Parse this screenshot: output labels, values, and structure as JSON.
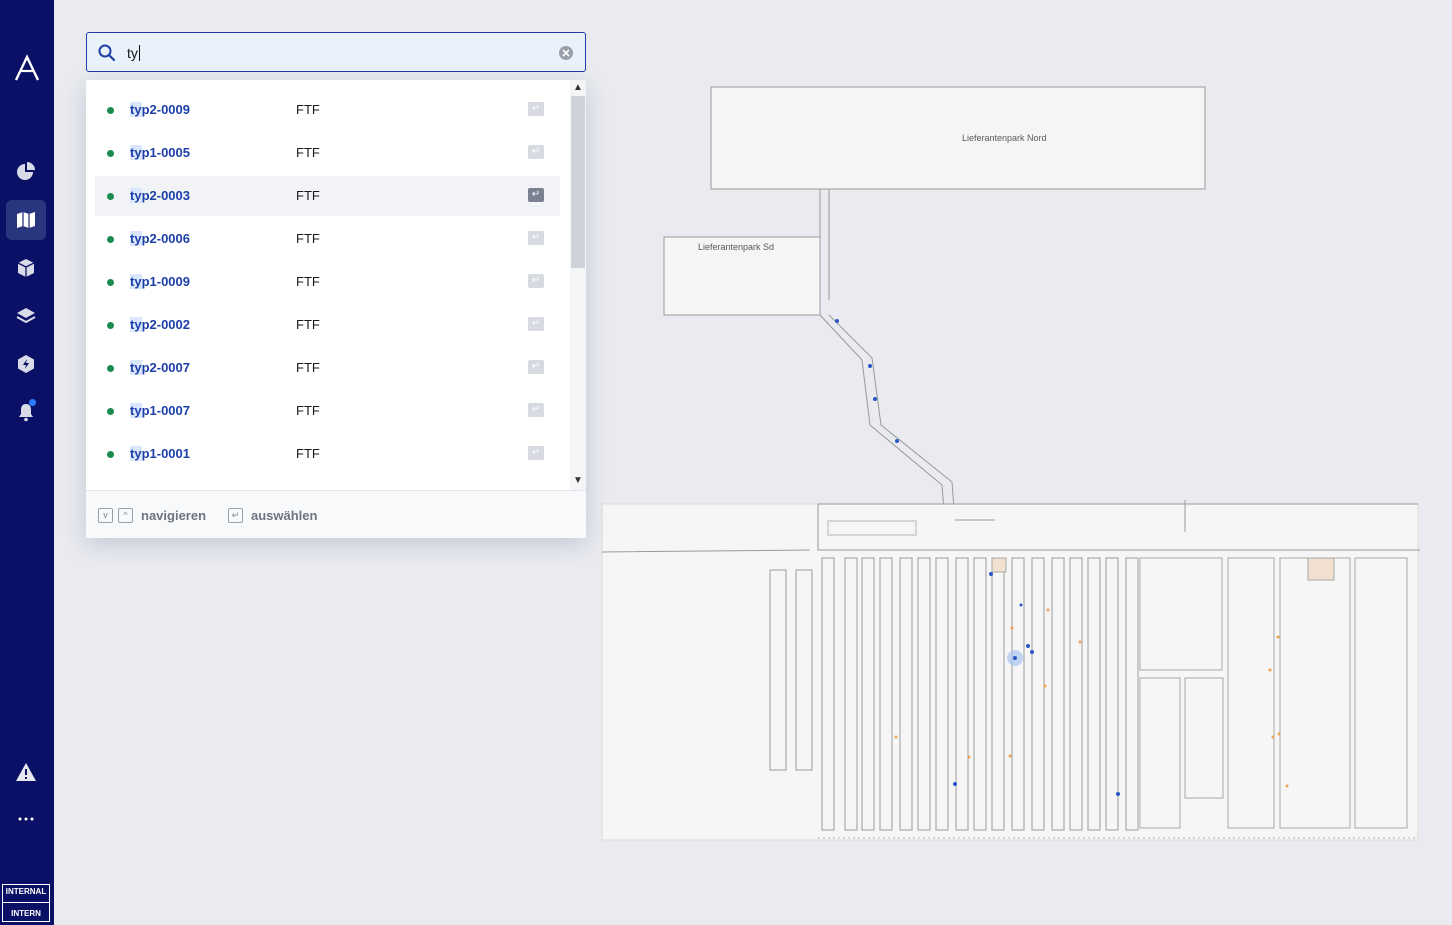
{
  "sidebar": {
    "badge_line1": "INTERNAL",
    "badge_line2": "INTERN",
    "nav": [
      "dashboard",
      "map",
      "packages",
      "layers",
      "automation",
      "notifications"
    ],
    "active": "map"
  },
  "search": {
    "value": "ty",
    "placeholder": ""
  },
  "results": [
    {
      "prefix": "ty",
      "rest": "p2-0009",
      "type": "FTF"
    },
    {
      "prefix": "ty",
      "rest": "p1-0005",
      "type": "FTF"
    },
    {
      "prefix": "ty",
      "rest": "p2-0003",
      "type": "FTF"
    },
    {
      "prefix": "ty",
      "rest": "p2-0006",
      "type": "FTF"
    },
    {
      "prefix": "ty",
      "rest": "p1-0009",
      "type": "FTF"
    },
    {
      "prefix": "ty",
      "rest": "p2-0002",
      "type": "FTF"
    },
    {
      "prefix": "ty",
      "rest": "p2-0007",
      "type": "FTF"
    },
    {
      "prefix": "ty",
      "rest": "p1-0007",
      "type": "FTF"
    },
    {
      "prefix": "ty",
      "rest": "p1-0001",
      "type": "FTF"
    }
  ],
  "selected_index": 2,
  "footer": {
    "navigate": "navigieren",
    "select": "auswählen"
  },
  "map": {
    "zone_north": "Lieferantenpark Nord",
    "zone_south": "Lieferantenpark Sd"
  },
  "colors": {
    "sidebar": "#0a1066",
    "accent": "#1d3fa8",
    "status_online": "#1b8a4e"
  }
}
